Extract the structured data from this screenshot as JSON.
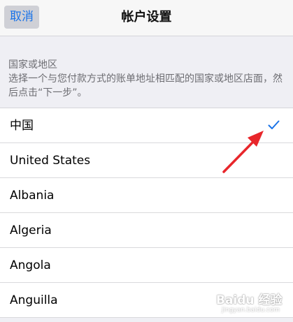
{
  "navbar": {
    "cancel_label": "取消",
    "title": "帐户设置"
  },
  "section": {
    "title": "国家或地区",
    "description": "选择一个与您付款方式的账单地址相匹配的国家或地区店面，然后点击“下一步”。"
  },
  "countries": [
    {
      "label": "中国",
      "selected": true
    },
    {
      "label": "United States",
      "selected": false
    },
    {
      "label": "Albania",
      "selected": false
    },
    {
      "label": "Algeria",
      "selected": false
    },
    {
      "label": "Angola",
      "selected": false
    },
    {
      "label": "Anguilla",
      "selected": false
    }
  ],
  "colors": {
    "accent": "#1a73e8",
    "annotation_arrow": "#e8262b",
    "background": "#efeff4"
  },
  "watermark": {
    "text": "Baidu 经验",
    "url": "jingyan.baidu.com"
  }
}
